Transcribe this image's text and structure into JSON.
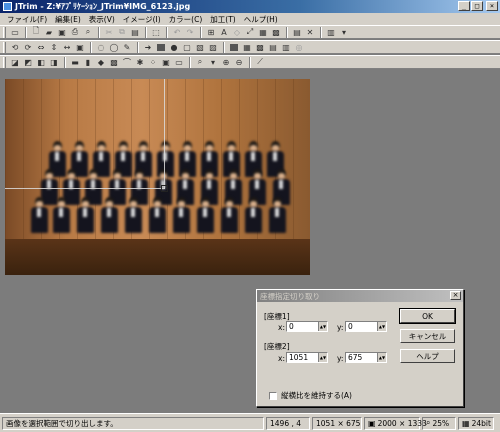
{
  "window": {
    "title": "JTrim - Z:¥ｱﾌﾟﾘｹｰｼｮﾝ_JTrim¥IMG_6123.jpg",
    "minimize": "_",
    "maximize": "□",
    "close": "×"
  },
  "menu": {
    "items": [
      {
        "label": "ファイル(F)"
      },
      {
        "label": "編集(E)"
      },
      {
        "label": "表示(V)"
      },
      {
        "label": "イメージ(I)"
      },
      {
        "label": "カラー(C)"
      },
      {
        "label": "加工(T)"
      },
      {
        "label": "ヘルプ(H)"
      }
    ]
  },
  "dialog": {
    "title": "座標指定切り取り",
    "close": "×",
    "coord1_label": "[座標1]",
    "coord2_label": "[座標2]",
    "x_label": "x:",
    "y_label": "y:",
    "coord1_x": "0",
    "coord1_y": "0",
    "coord2_x": "1051",
    "coord2_y": "675",
    "ok_label": "OK",
    "cancel_label": "キャンセル",
    "help_label": "ヘルプ",
    "keep_ratio_label": "縦横比を維持する(A)",
    "keep_ratio_checked": false
  },
  "status": {
    "message": "画像を選択範囲で切り出します。",
    "cursor": "1496 , 4",
    "selection": "1051 × 675",
    "image_size": "2000 × 1333",
    "zoom": "25%",
    "bit_depth": "24bit"
  },
  "colors": {
    "titlebar": "#0a246a",
    "dialog_titlebar_inactive": "#808080",
    "workspace": "#7c7c7c",
    "face": "#d4d0c8"
  }
}
